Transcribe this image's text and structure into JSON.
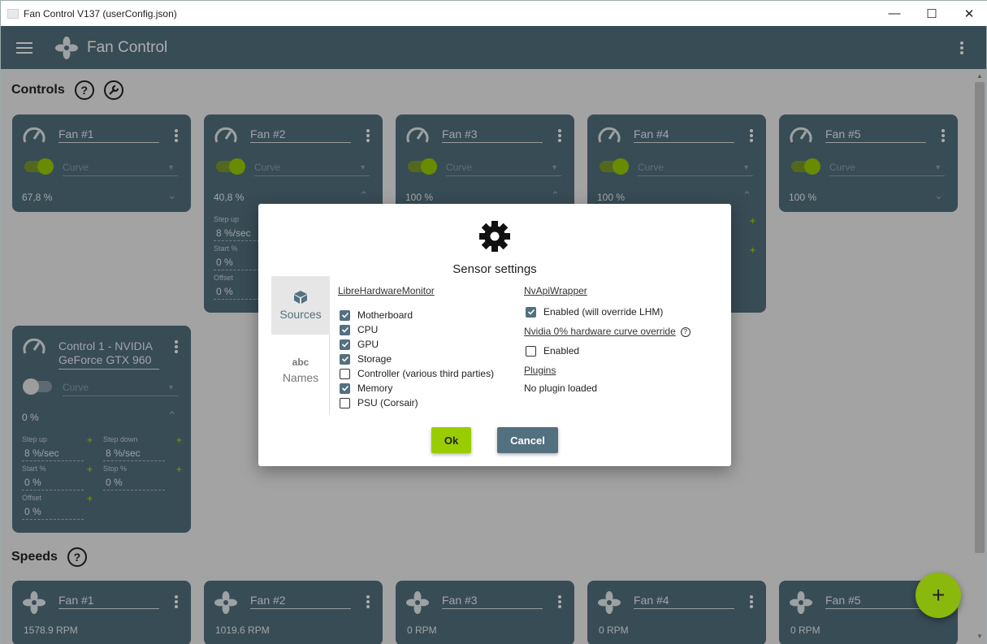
{
  "window": {
    "title": "Fan Control V137 (userConfig.json)",
    "minimize": "—",
    "maximize": "☐",
    "close": "✕"
  },
  "appbar": {
    "title": "Fan Control"
  },
  "sections": {
    "controls": "Controls",
    "speeds": "Speeds",
    "help": "?"
  },
  "control_cards": [
    {
      "name": "Fan #1",
      "mode": "Curve",
      "value": "67,8 %",
      "enabled": true
    },
    {
      "name": "Fan #2",
      "mode": "Curve",
      "value": "40,8 %",
      "enabled": true
    },
    {
      "name": "Fan #3",
      "mode": "Curve",
      "value": "100 %",
      "enabled": true
    },
    {
      "name": "Fan #4",
      "mode": "Curve",
      "value": "100 %",
      "enabled": true
    },
    {
      "name": "Fan #5",
      "mode": "Curve",
      "value": "100 %",
      "enabled": true
    }
  ],
  "fan2_details": {
    "step_up_label": "Step up",
    "step_up": "8 %/sec",
    "start_label": "Start %",
    "start": "0 %",
    "offset_label": "Offset",
    "offset": "0 %"
  },
  "control6": {
    "name_line1": "Control 1 - NVIDIA",
    "name_line2": "GeForce GTX 960",
    "mode": "Curve",
    "value": "0 %",
    "step_up_label": "Step up",
    "step_up": "8 %/sec",
    "step_down_label": "Step down",
    "step_down": "8 %/sec",
    "start_label": "Start %",
    "start": "0 %",
    "stop_label": "Stop %",
    "stop": "0 %",
    "offset_label": "Offset",
    "offset": "0 %"
  },
  "speed_cards": [
    {
      "name": "Fan #1",
      "rpm": "1578.9 RPM"
    },
    {
      "name": "Fan #2",
      "rpm": "1019.6 RPM"
    },
    {
      "name": "Fan #3",
      "rpm": "0 RPM"
    },
    {
      "name": "Fan #4",
      "rpm": "0 RPM"
    },
    {
      "name": "Fan #5",
      "rpm": "0 RPM"
    }
  ],
  "dialog": {
    "title": "Sensor settings",
    "nav": {
      "sources": "Sources",
      "names": "Names",
      "names_icon": "abc"
    },
    "lhm": {
      "heading": "LibreHardwareMonitor",
      "items": [
        {
          "label": "Motherboard",
          "checked": true
        },
        {
          "label": "CPU",
          "checked": true
        },
        {
          "label": "GPU",
          "checked": true
        },
        {
          "label": "Storage",
          "checked": true
        },
        {
          "label": "Controller (various third parties)",
          "checked": false
        },
        {
          "label": "Memory",
          "checked": true
        },
        {
          "label": "PSU (Corsair)",
          "checked": false
        }
      ]
    },
    "nvapi": {
      "heading": "NvApiWrapper",
      "enabled_label": "Enabled (will override LHM)",
      "enabled": true
    },
    "nvidia0": {
      "heading": "Nvidia 0% hardware curve override",
      "enabled_label": "Enabled",
      "enabled": false
    },
    "plugins": {
      "heading": "Plugins",
      "status": "No plugin loaded"
    },
    "ok": "Ok",
    "cancel": "Cancel"
  },
  "fab": {
    "label": "+"
  },
  "colors": {
    "accent": "#9acd00",
    "card": "#53707f",
    "appbar": "#53707f"
  }
}
